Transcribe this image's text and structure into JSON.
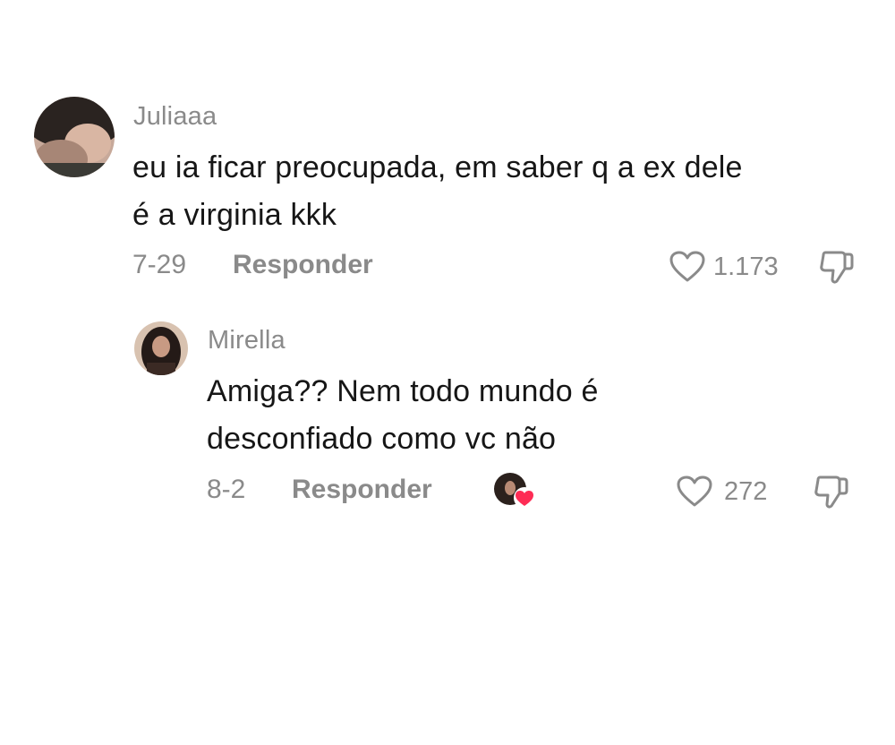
{
  "comments": [
    {
      "username": "Juliaaa",
      "text_line1": "eu ia ficar preocupada, em saber q a ex dele",
      "text_line2": "é a virginia kkk",
      "date": "7-29",
      "reply_label": "Responder",
      "likes": "1.173"
    },
    {
      "username": "Mirella",
      "text_line1": "Amiga?? Nem todo mundo é",
      "text_line2": "desconfiado como vc não",
      "date": "8-2",
      "reply_label": "Responder",
      "likes": "272",
      "liked_by_creator": true
    }
  ],
  "icons": {
    "like": "heart-outline-icon",
    "dislike": "thumbs-down-icon",
    "creator_like": "heart-filled-icon"
  },
  "colors": {
    "text": "#161616",
    "secondary": "#8a8a8a",
    "heart_badge": "#fe2c55"
  }
}
